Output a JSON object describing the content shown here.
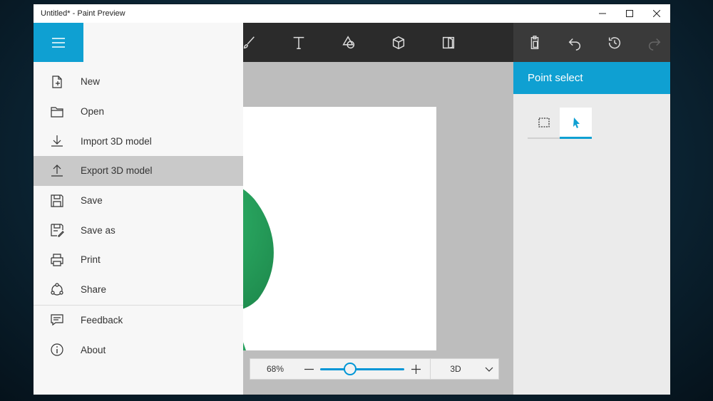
{
  "window": {
    "title": "Untitled* - Paint Preview"
  },
  "menu": {
    "items": [
      {
        "label": "New",
        "icon": "new-file-icon"
      },
      {
        "label": "Open",
        "icon": "folder-icon"
      },
      {
        "label": "Import 3D model",
        "icon": "import-icon"
      },
      {
        "label": "Export 3D model",
        "icon": "export-icon"
      },
      {
        "label": "Save",
        "icon": "save-icon"
      },
      {
        "label": "Save as",
        "icon": "save-as-icon"
      },
      {
        "label": "Print",
        "icon": "print-icon"
      },
      {
        "label": "Share",
        "icon": "share-icon"
      },
      {
        "label": "Feedback",
        "icon": "feedback-icon"
      },
      {
        "label": "About",
        "icon": "info-icon"
      }
    ],
    "active_item": "Export 3D model"
  },
  "panel": {
    "title": "Point select"
  },
  "zoom": {
    "percent": "68%",
    "level": 0.36,
    "mode": "3D"
  },
  "colors": {
    "accent": "#0fa0d2",
    "toolbar": "#2b2b2b",
    "shape": "#27a35e"
  }
}
